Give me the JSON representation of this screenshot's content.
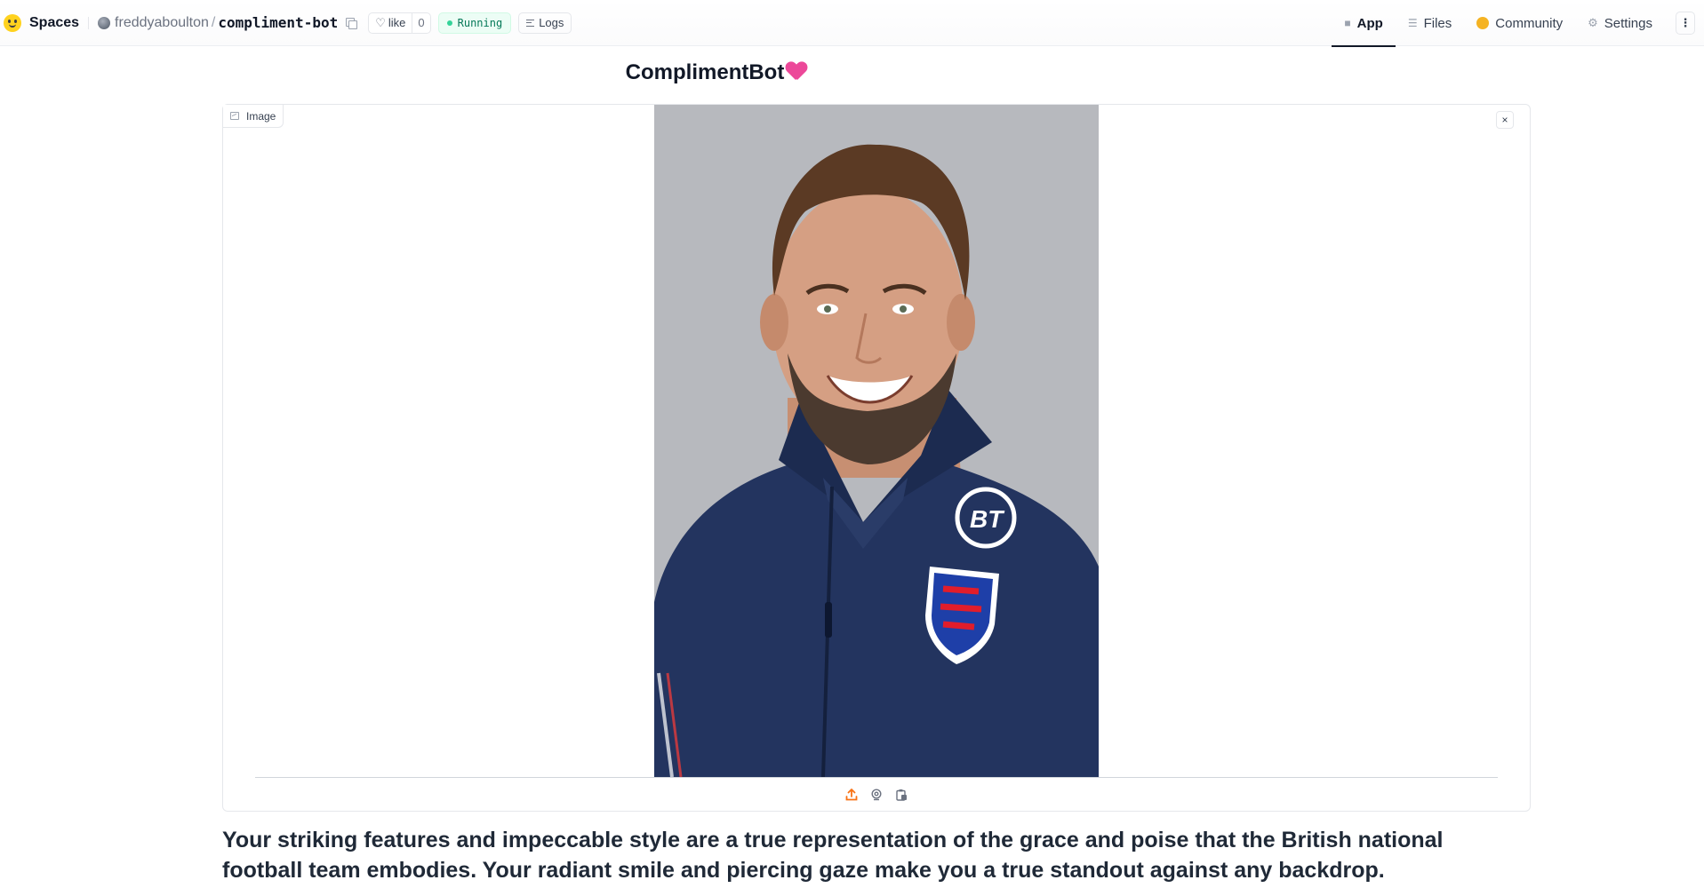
{
  "header": {
    "brand_label": "Spaces",
    "owner": "freddyaboulton",
    "separator": "/",
    "repo_name": "compliment-bot",
    "like_label": "like",
    "like_count": "0",
    "status": "Running",
    "logs_label": "Logs",
    "nav_tabs": [
      {
        "label": "App",
        "icon": "cube-icon",
        "active": true
      },
      {
        "label": "Files",
        "icon": "files-icon",
        "active": false
      },
      {
        "label": "Community",
        "icon": "community-icon",
        "active": false
      },
      {
        "label": "Settings",
        "icon": "gear-icon",
        "active": false
      }
    ],
    "more_label": "⋮"
  },
  "main": {
    "title": "ComplimentBot",
    "title_emoji": "sparkling-heart-icon",
    "image_panel": {
      "label": "Image",
      "clear_label": "×",
      "source_icons": [
        "upload-icon",
        "webcam-icon",
        "clipboard-icon"
      ]
    },
    "output_text": "Your striking features and impeccable style are a true representation of the grace and poise that the British national football team embodies. Your radiant smile and piercing gaze make you a true standout against any backdrop."
  },
  "colors": {
    "status_green": "#047857",
    "upload_accent": "#f97316",
    "jacket_navy": "#23345f",
    "heart_pink": "#ec4899"
  }
}
